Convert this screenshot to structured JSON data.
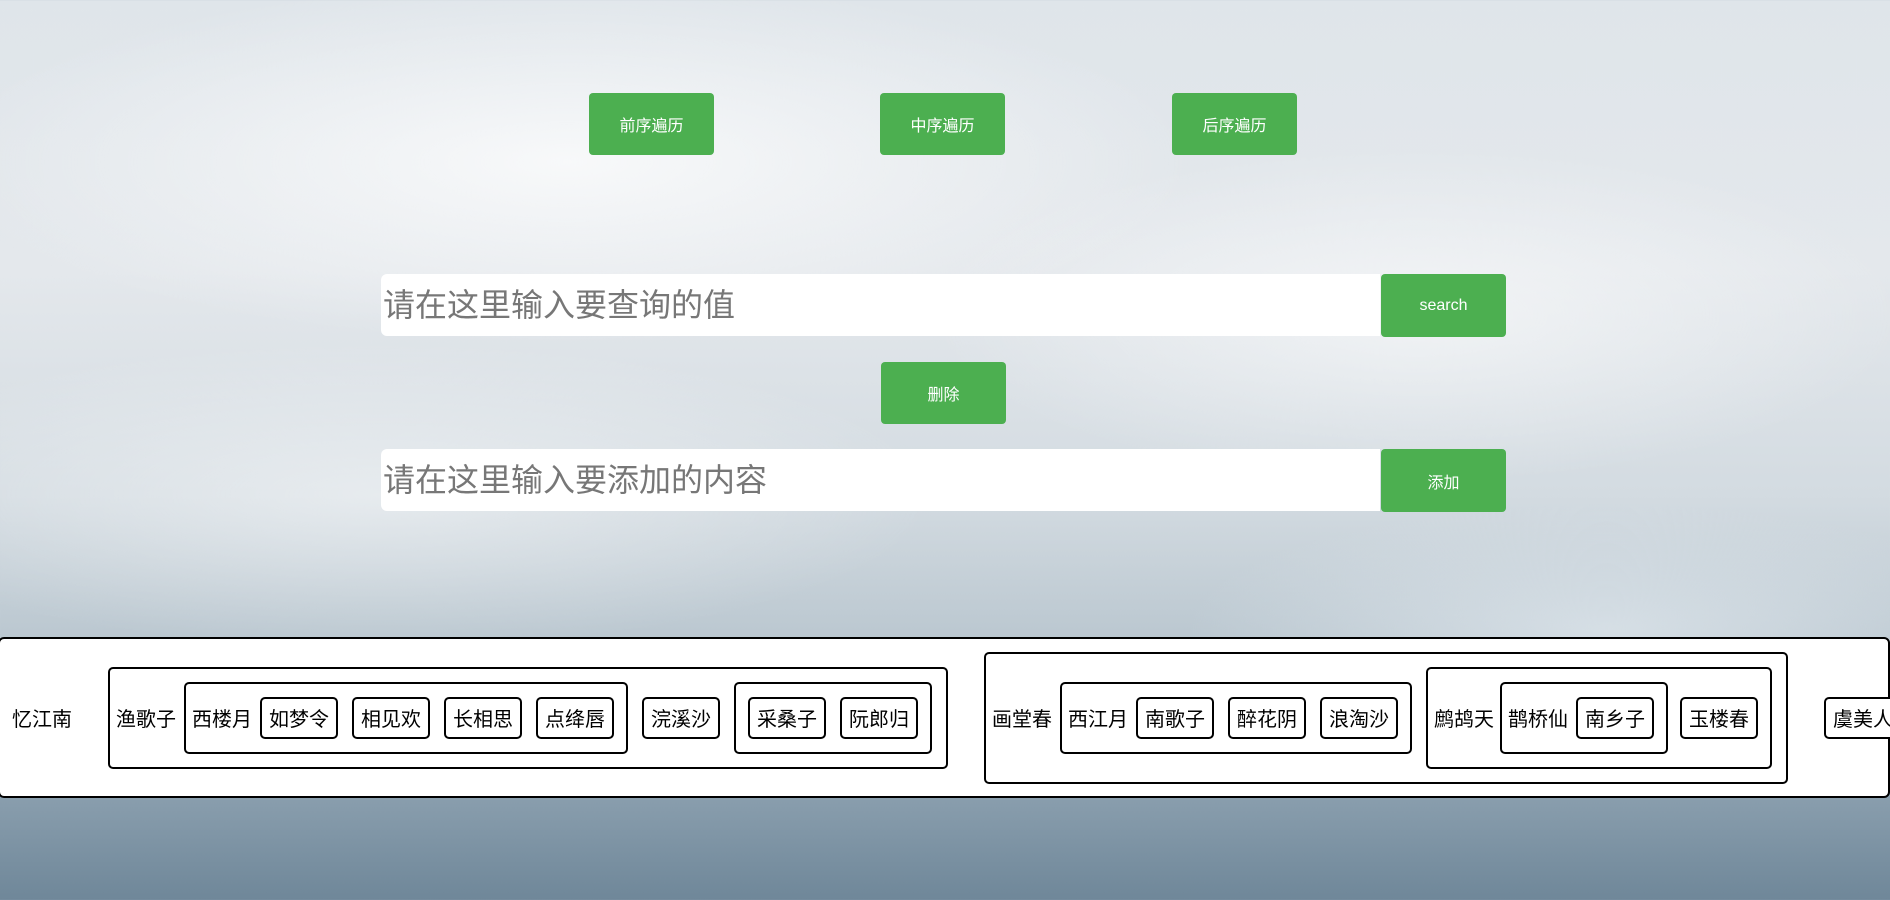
{
  "traversal_buttons": {
    "preorder": "前序遍历",
    "inorder": "中序遍历",
    "postorder": "后序遍历"
  },
  "search": {
    "placeholder": "请在这里输入要查询的值",
    "button": "search"
  },
  "delete_button": "删除",
  "add": {
    "placeholder": "请在这里输入要添加的内容",
    "button": "添加"
  },
  "tree": {
    "root": "忆江南",
    "left": {
      "label": "渔歌子",
      "left": {
        "label": "西楼月",
        "leaves": [
          "如梦令",
          "相见欢",
          "长相思",
          "点绛唇"
        ]
      },
      "middle": "浣溪沙",
      "right": {
        "leaves": [
          "采桑子",
          "阮郎归"
        ]
      }
    },
    "right": {
      "label": "画堂春",
      "left": {
        "label": "西江月",
        "leaves": [
          "南歌子",
          "醉花阴",
          "浪淘沙"
        ]
      },
      "right": {
        "label": "鹧鸪天",
        "inner": {
          "label": "鹊桥仙",
          "leaf": "南乡子"
        },
        "leaf": "玉楼春"
      }
    },
    "far_right": "虞美人"
  },
  "colors": {
    "button_green": "#4caf50",
    "button_text": "#ffffff",
    "border": "#000000"
  }
}
